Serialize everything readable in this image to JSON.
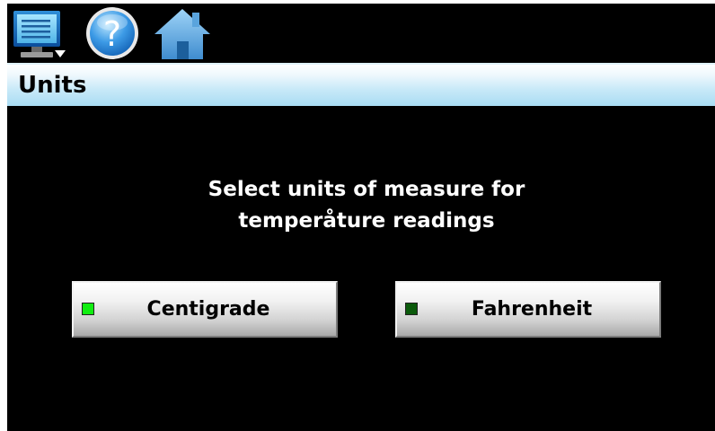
{
  "toolbar": {
    "icons": [
      "monitor-menu-icon",
      "help-icon",
      "home-icon"
    ]
  },
  "page": {
    "title": "Units"
  },
  "instructions": {
    "line1": "Select units of measure for",
    "line2": "temperåture readings"
  },
  "options": {
    "centigrade": {
      "label": "Centigrade",
      "selected": true,
      "indicator_color": "#11ee11"
    },
    "fahrenheit": {
      "label": "Fahrenheit",
      "selected": false,
      "indicator_color": "#0b5a0b"
    }
  },
  "colors": {
    "background": "#000000",
    "title_bar": "#bfe5f7",
    "text_light": "#ffffff"
  }
}
